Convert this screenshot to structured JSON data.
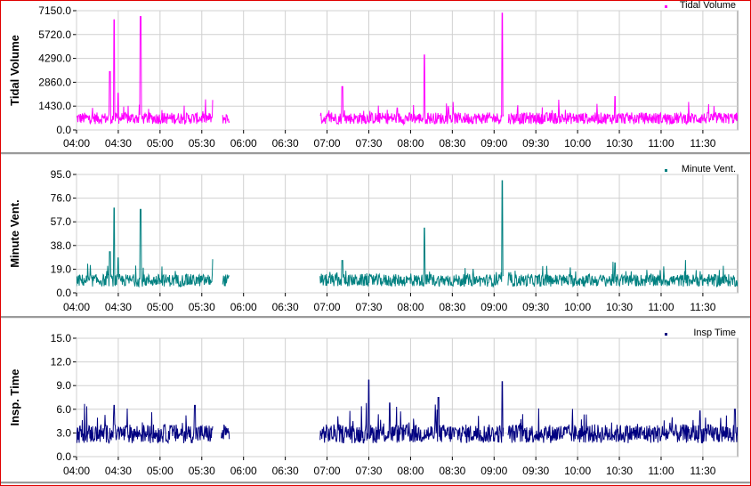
{
  "chart_data": [
    {
      "type": "line",
      "ylabel": "Tidal Volume",
      "legend": "Tidal Volume",
      "legend_position": "top-right",
      "color": "#ff00ff",
      "ylim": [
        0,
        7150
      ],
      "yticks": [
        "0.0",
        "1430.0",
        "2860.0",
        "4290.0",
        "5720.0",
        "7150.0"
      ],
      "xlim": [
        "04:00",
        "11:55"
      ],
      "xticks": [
        "04:00",
        "04:30",
        "05:00",
        "05:30",
        "06:00",
        "06:30",
        "07:00",
        "07:30",
        "08:00",
        "08:30",
        "09:00",
        "09:30",
        "10:00",
        "10:30",
        "11:00",
        "11:30"
      ],
      "grid": true,
      "segments": [
        [
          "03:55",
          "05:38"
        ],
        [
          "05:45",
          "05:50"
        ],
        [
          "06:55",
          "09:07"
        ],
        [
          "09:10",
          "11:55"
        ]
      ],
      "baseline": 700,
      "noise": 350,
      "spikes": [
        [
          "04:24",
          3500
        ],
        [
          "04:27",
          6600
        ],
        [
          "04:30",
          2200
        ],
        [
          "04:46",
          6800
        ],
        [
          "05:38",
          1800
        ],
        [
          "07:11",
          2600
        ],
        [
          "08:10",
          4500
        ],
        [
          "09:06",
          7000
        ],
        [
          "10:27",
          2000
        ]
      ]
    },
    {
      "type": "line",
      "ylabel": "Minute Vent.",
      "legend": "Minute Vent.",
      "legend_position": "top-right",
      "color": "#008080",
      "ylim": [
        0,
        95
      ],
      "yticks": [
        "0.0",
        "19.0",
        "38.0",
        "57.0",
        "76.0",
        "95.0"
      ],
      "xlim": [
        "04:00",
        "11:55"
      ],
      "xticks": [
        "04:00",
        "04:30",
        "05:00",
        "05:30",
        "06:00",
        "06:30",
        "07:00",
        "07:30",
        "08:00",
        "08:30",
        "09:00",
        "09:30",
        "10:00",
        "10:30",
        "11:00",
        "11:30"
      ],
      "grid": true,
      "segments": [
        [
          "03:55",
          "05:38"
        ],
        [
          "05:45",
          "05:50"
        ],
        [
          "06:55",
          "09:07"
        ],
        [
          "09:10",
          "11:55"
        ]
      ],
      "baseline": 10,
      "noise": 5,
      "spikes": [
        [
          "04:24",
          33
        ],
        [
          "04:27",
          68
        ],
        [
          "04:30",
          28
        ],
        [
          "04:46",
          67
        ],
        [
          "05:38",
          27
        ],
        [
          "07:11",
          26
        ],
        [
          "08:10",
          52
        ],
        [
          "09:06",
          90
        ],
        [
          "10:27",
          24
        ]
      ]
    },
    {
      "type": "line",
      "ylabel": "Insp. Time",
      "legend": "Insp Time",
      "legend_position": "top-right",
      "color": "#000080",
      "ylim": [
        0,
        15
      ],
      "yticks": [
        "0.0",
        "3.0",
        "6.0",
        "9.0",
        "12.0",
        "15.0"
      ],
      "xlim": [
        "04:00",
        "11:55"
      ],
      "xticks": [
        "04:00",
        "04:30",
        "05:00",
        "05:30",
        "06:00",
        "06:30",
        "07:00",
        "07:30",
        "08:00",
        "08:30",
        "09:00",
        "09:30",
        "10:00",
        "10:30",
        "11:00",
        "11:30"
      ],
      "grid": true,
      "segments": [
        [
          "03:55",
          "05:38"
        ],
        [
          "05:44",
          "05:50"
        ],
        [
          "06:55",
          "09:07"
        ],
        [
          "09:10",
          "11:55"
        ]
      ],
      "baseline": 2.9,
      "noise": 1.2,
      "spikes": [
        [
          "04:27",
          6.5
        ],
        [
          "05:25",
          6.5
        ],
        [
          "07:30",
          9.7
        ],
        [
          "07:45",
          6.8
        ],
        [
          "08:20",
          7.5
        ],
        [
          "09:06",
          9.5
        ],
        [
          "11:28",
          5.8
        ],
        [
          "11:53",
          6.0
        ]
      ]
    }
  ]
}
